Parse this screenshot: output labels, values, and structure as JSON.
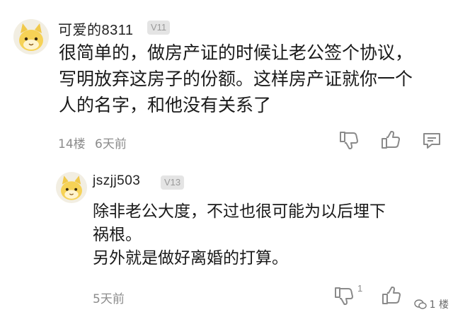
{
  "comment": {
    "username": "可爱的8311",
    "level": "V11",
    "lines": "很简单的，做房产证的时候让老公签个协议，\n写明放弃这房子的份额。这样房产证就你一个\n人的名字，和他没有关系了",
    "floor": "14楼",
    "time": "6天前"
  },
  "reply": {
    "username": "jszjj503",
    "level": "V13",
    "lines": "除非老公大度，不过也很可能为以后埋下\n祸根。\n另外就是做好离婚的打算。",
    "time": "5天前",
    "dislike_count": "1"
  },
  "watermark": {
    "text": "1 楼"
  }
}
